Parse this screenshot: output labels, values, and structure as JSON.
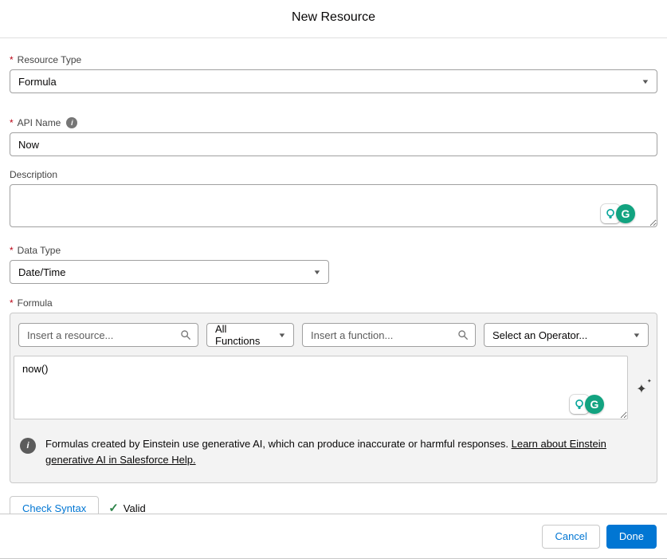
{
  "title": "New Resource",
  "ui": {
    "required_marker": "*"
  },
  "fields": {
    "resource_type": {
      "label": "Resource Type",
      "value": "Formula",
      "required": true
    },
    "api_name": {
      "label": "API Name",
      "value": "Now",
      "required": true
    },
    "description": {
      "label": "Description",
      "value": ""
    },
    "data_type": {
      "label": "Data Type",
      "value": "Date/Time",
      "required": true
    },
    "formula": {
      "label": "Formula",
      "value": "now()",
      "required": true
    }
  },
  "toolbar": {
    "resource_placeholder": "Insert a resource...",
    "functions_value": "All Functions",
    "function_placeholder": "Insert a function...",
    "operator_value": "Select an Operator..."
  },
  "notice": {
    "text": "Formulas created by Einstein use generative AI, which can produce inaccurate or harmful responses.",
    "link": "Learn about Einstein generative AI in Salesforce Help."
  },
  "syntax": {
    "button": "Check Syntax",
    "status": "Valid"
  },
  "footer": {
    "cancel": "Cancel",
    "done": "Done"
  },
  "icons": {
    "chevron_down": "▼",
    "info_letter": "i",
    "grammarly_letter": "G",
    "sparkle": "✦",
    "sparkle_small": "✦",
    "check": "✓"
  },
  "colors": {
    "accent": "#0176d3",
    "required_red": "#ba0517",
    "valid_green": "#2e844a",
    "einstein_teal": "#06a59a",
    "grammarly_green": "#12a380"
  }
}
